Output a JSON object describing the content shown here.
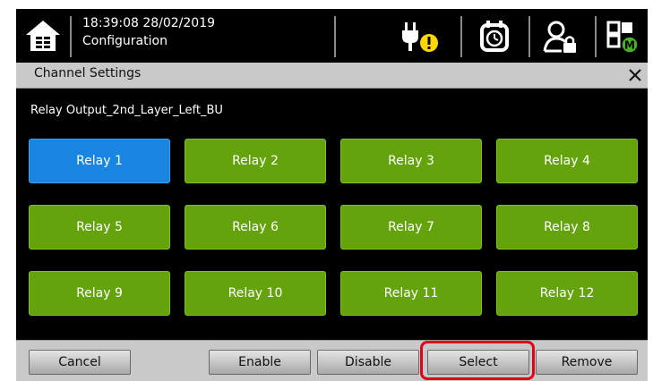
{
  "status_bar": {
    "time_date": "18:39:08 28/02/2019",
    "mode": "Configuration",
    "icons": [
      "home-icon",
      "power-plug-warning-icon",
      "alarm-clock-icon",
      "user-lock-icon",
      "grid-m-icon"
    ]
  },
  "dialog": {
    "title": "Channel Settings",
    "output_name": "Relay Output_2nd_Layer_Left_BU"
  },
  "relays": [
    {
      "label": "Relay 1",
      "selected": true
    },
    {
      "label": "Relay 2",
      "selected": false
    },
    {
      "label": "Relay 3",
      "selected": false
    },
    {
      "label": "Relay 4",
      "selected": false
    },
    {
      "label": "Relay 5",
      "selected": false
    },
    {
      "label": "Relay 6",
      "selected": false
    },
    {
      "label": "Relay 7",
      "selected": false
    },
    {
      "label": "Relay 8",
      "selected": false
    },
    {
      "label": "Relay 9",
      "selected": false
    },
    {
      "label": "Relay 10",
      "selected": false
    },
    {
      "label": "Relay 11",
      "selected": false
    },
    {
      "label": "Relay 12",
      "selected": false
    }
  ],
  "buttons": {
    "cancel": "Cancel",
    "enable": "Enable",
    "disable": "Disable",
    "select": "Select",
    "remove": "Remove"
  },
  "colors": {
    "relay_default": "#65a30d",
    "relay_selected": "#1886e0",
    "warning": "#ffd700",
    "highlight": "#e0001a"
  }
}
